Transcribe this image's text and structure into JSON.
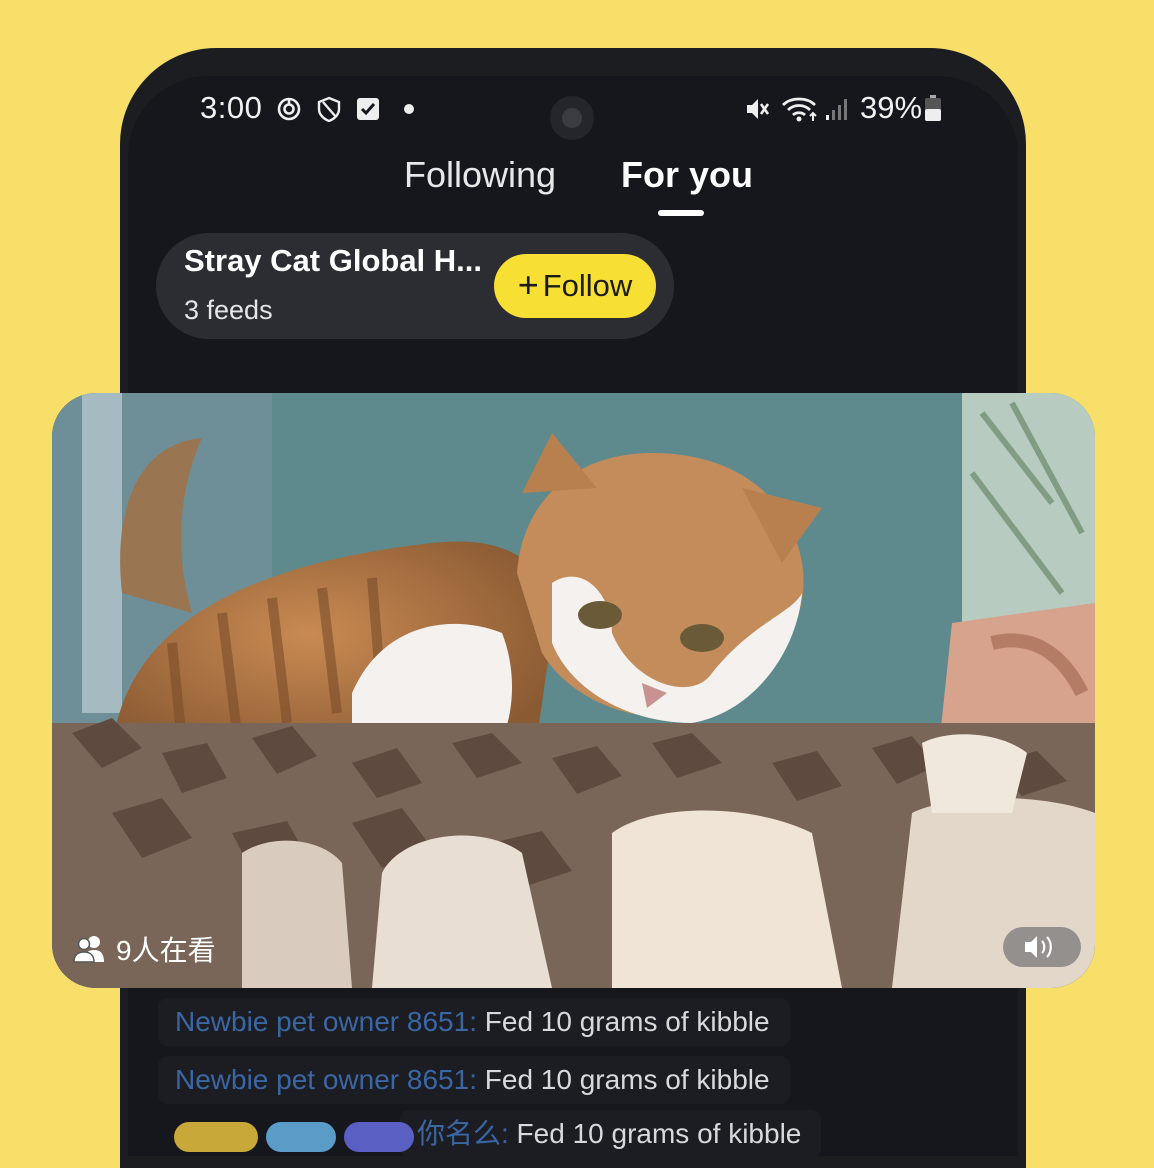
{
  "status_bar": {
    "time": "3:00",
    "battery": "39%",
    "icons": [
      "circle-target-icon",
      "shield-icon",
      "checkbox-icon",
      "dot-icon",
      "mute-icon",
      "wifi-icon",
      "signal-icon",
      "battery-icon"
    ]
  },
  "tabs": [
    {
      "label": "Following",
      "active": false
    },
    {
      "label": "For you",
      "active": true
    }
  ],
  "channel": {
    "name": "Stray Cat Global H...",
    "feeds": "3 feeds",
    "follow_label": "Follow"
  },
  "video": {
    "viewers": "9人在看",
    "sound": "on"
  },
  "chat": [
    {
      "user": "Newbie pet owner 8651:",
      "message": " Fed 10 grams of kibble"
    },
    {
      "user": "Newbie pet owner 8651:",
      "message": " Fed 10 grams of kibble"
    },
    {
      "user": "你名么:",
      "message": " Fed 10 grams of kibble"
    }
  ],
  "colors": {
    "background": "#f8df6a",
    "phone": "#1c1d21",
    "follow_button": "#f7df33",
    "chat_username": "#3a66a4"
  }
}
